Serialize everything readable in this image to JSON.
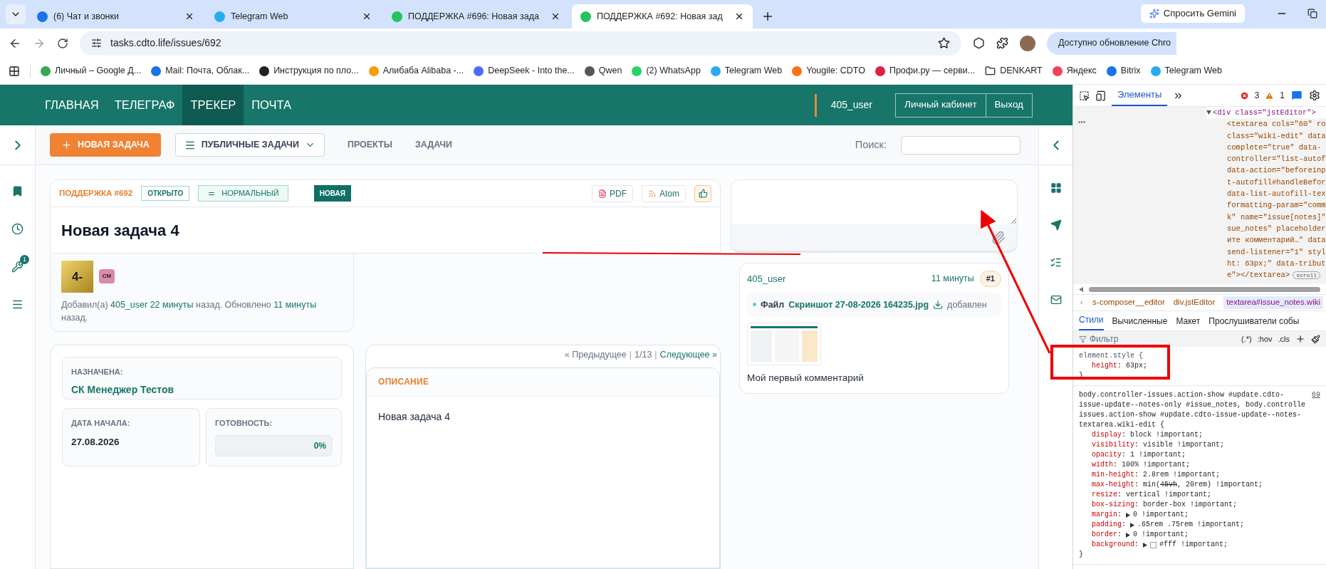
{
  "browser_tabs": [
    {
      "title": "(6) Чат и звонки",
      "selected": false
    },
    {
      "title": "Telegram Web",
      "selected": false
    },
    {
      "title": "ПОДДЕРЖКА #696: Новая зада",
      "selected": false
    },
    {
      "title": "ПОДДЕРЖКА #692: Новая зад",
      "selected": true
    }
  ],
  "gemini_button": "Спросить Gemini",
  "address": "tasks.cdto.life/issues/692",
  "update_button": "Доступно обновление Chro",
  "bookmarks": [
    {
      "title": "Личный – Google Д...",
      "kind": "site"
    },
    {
      "title": "Mail: Почта, Облак...",
      "kind": "site"
    },
    {
      "title": "Инструкция по пло...",
      "kind": "site"
    },
    {
      "title": "Алибаба Alibaba -...",
      "kind": "site"
    },
    {
      "title": "DeepSeek - Into the...",
      "kind": "site"
    },
    {
      "title": "Qwen",
      "kind": "site"
    },
    {
      "title": "(2) WhatsApp",
      "kind": "site"
    },
    {
      "title": "Telegram Web",
      "kind": "site"
    },
    {
      "title": "Yougile: CDTO",
      "kind": "site"
    },
    {
      "title": "Профи.ру — серви...",
      "kind": "site"
    },
    {
      "title": "DENKART",
      "kind": "folder"
    },
    {
      "title": "Яндекс",
      "kind": "site"
    },
    {
      "title": "Bitrix",
      "kind": "site"
    },
    {
      "title": "Telegram Web",
      "kind": "site"
    }
  ],
  "app_nav": [
    {
      "label": "ГЛАВНАЯ",
      "selected": false
    },
    {
      "label": "ТЕЛЕГРАФ",
      "selected": false
    },
    {
      "label": "ТРЕКЕР",
      "selected": true
    },
    {
      "label": "ПОЧТА",
      "selected": false
    }
  ],
  "user": "405_user",
  "account_buttons": [
    "Личный кабинет",
    "Выход"
  ],
  "toolbar": {
    "new_task": "НОВАЯ ЗАДАЧА",
    "filter": "ПУБЛИЧНЫЕ ЗАДАЧИ",
    "links": [
      "ПРОЕКТЫ",
      "ЗАДАЧИ"
    ],
    "search_label": "Поиск:"
  },
  "sidebar_badge": "1",
  "issue": {
    "tracker": "ПОДДЕРЖКА #692",
    "status": "ОТКРЫТО",
    "priority": "НОРМАЛЬНЫЙ",
    "state_badge": "НОВАЯ",
    "actions": [
      "PDF",
      "Atom"
    ],
    "title": "Новая задача 4",
    "avatar": "4-",
    "watcher": "СМ",
    "meta": [
      {
        "kind": "text",
        "text": "Добавил(а)"
      },
      {
        "kind": "link",
        "text": "405_user"
      },
      {
        "kind": "link",
        "text": "22 минуты"
      },
      {
        "kind": "text",
        "text": "назад. Обновлено"
      },
      {
        "kind": "link",
        "text": "11 минуты"
      },
      {
        "kind": "text",
        "text": "назад."
      }
    ]
  },
  "fields": {
    "assignee_label": "НАЗНАЧЕНА:",
    "assignee": "СК Менеджер Тестов",
    "start_label": "ДАТА НАЧАЛА:",
    "start": "27.08.2026",
    "done_label": "ГОТОВНОСТЬ:",
    "done": "0%",
    "level": 0
  },
  "pagination": {
    "prev": "« Предыдущее",
    "separators": [
      "|",
      "|"
    ],
    "position": "1/13",
    "next": "Следующее »"
  },
  "description": {
    "heading": "ОПИСАНИЕ",
    "text": "Новая задача 4"
  },
  "comment": {
    "author": "405_user",
    "time": "11 минуты",
    "number": "#1",
    "file_label": "Файл",
    "file_name": "Скриншот 27-08-2026 164235.jpg",
    "file_action": "добавлен",
    "text": "Мой первый комментарий"
  },
  "devtools": {
    "tabs": [
      {
        "label": "Элементы",
        "selected": true
      }
    ],
    "errors": "3",
    "warnings": "1",
    "dom": {
      "text": "<div class=\"jstEditor\">",
      "expanded": true,
      "children": [
        {
          "lines": [
            "<textarea cols=\"60\" ro",
            "class=\"wiki-edit\" data",
            "complete=\"true\" data-",
            "controller=\"list-autof",
            "data-action=\"beforeinp",
            "t-autofill#handleBefor",
            "data-list-autofill-tex",
            "formatting-param=\"comm",
            "k\" name=\"issue[notes]\"",
            "sue_notes\" placeholder",
            "ите комментарий…\" data",
            "send-listener=\"1\" styl",
            "ht: 63px;\" data-tribut",
            "e\"></textarea>"
          ],
          "badge": "scroll"
        }
      ]
    },
    "breadcrumbs": [
      {
        "label": "s-composer__editor",
        "selected": false
      },
      {
        "label": "div.jstEditor",
        "selected": false
      },
      {
        "label": "textarea#issue_notes.wiki",
        "selected": true
      }
    ],
    "style_tabs": [
      {
        "label": "Стили",
        "selected": true
      },
      {
        "label": "Вычисленные",
        "selected": false
      },
      {
        "label": "Макет",
        "selected": false
      },
      {
        "label": "Прослушиватели собы",
        "selected": false
      }
    ],
    "colon": ":",
    "filter_placeholder": "Фильтр",
    "filter_tools": [
      "(.*)",
      ":hov",
      ".cls"
    ],
    "rules": [
      {
        "selector": [
          "element.style {"
        ],
        "close": "}",
        "decls": [
          {
            "prop": "height",
            "parts": [
              {
                "text": "63px;",
                "struck": false
              }
            ]
          }
        ]
      },
      {
        "selector": [
          "body.controller-issues.action-show #update.cdto-",
          "issue-update--notes-only #issue_notes, body.controlle",
          "issues.action-show #update.cdto-issue-update--notes-",
          "textarea.wiki-edit {"
        ],
        "source": "69",
        "close": "}",
        "decls": [
          {
            "prop": "display",
            "parts": [
              {
                "text": "block !important;",
                "struck": false
              }
            ]
          },
          {
            "prop": "visibility",
            "parts": [
              {
                "text": "visible !important;",
                "struck": false
              }
            ]
          },
          {
            "prop": "opacity",
            "parts": [
              {
                "text": "1 !important;",
                "struck": false
              }
            ]
          },
          {
            "prop": "width",
            "parts": [
              {
                "text": "100% !important;",
                "struck": false
              }
            ]
          },
          {
            "prop": "min-height",
            "parts": [
              {
                "text": "2.8rem !important;",
                "struck": false
              }
            ]
          },
          {
            "prop": "max-height",
            "parts": [
              {
                "text": "min(",
                "struck": false
              },
              {
                "text": "45vh",
                "struck": true
              },
              {
                "text": ", 20rem) !important;",
                "struck": false
              }
            ]
          },
          {
            "prop": "resize",
            "parts": [
              {
                "text": "vertical !important;",
                "struck": false
              }
            ]
          },
          {
            "prop": "box-sizing",
            "parts": [
              {
                "text": "border-box !important;",
                "struck": false
              }
            ]
          },
          {
            "prop": "margin",
            "expandable": true,
            "parts": [
              {
                "text": "0 !important;",
                "struck": false
              }
            ]
          },
          {
            "prop": "padding",
            "expandable": true,
            "parts": [
              {
                "text": ".65rem .75rem !important;",
                "struck": false
              }
            ]
          },
          {
            "prop": "border",
            "expandable": true,
            "parts": [
              {
                "text": "0 !important;",
                "struck": false
              }
            ]
          },
          {
            "prop": "background",
            "expandable": true,
            "color": "#ffffff",
            "parts": [
              {
                "text": "#fff !important;",
                "struck": false
              }
            ]
          }
        ]
      }
    ]
  }
}
